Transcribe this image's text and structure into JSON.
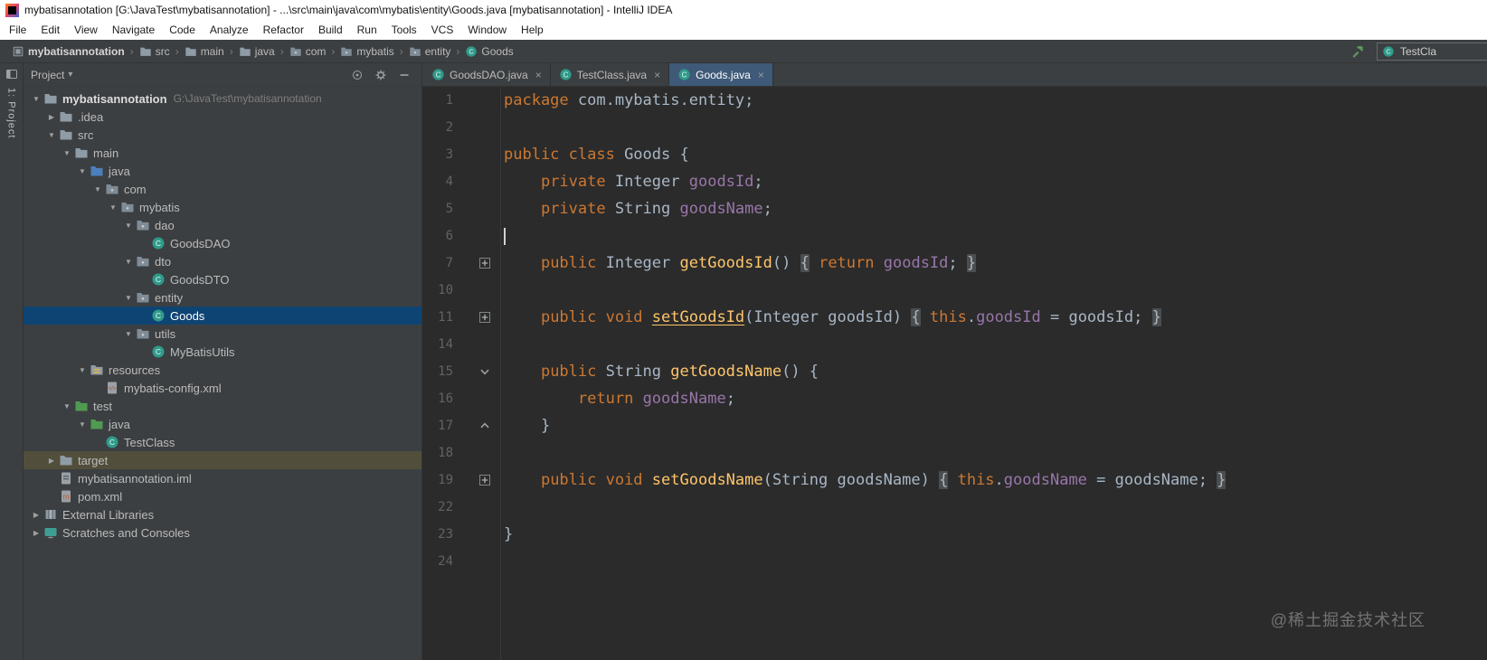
{
  "title_bar": {
    "title": "mybatisannotation [G:\\JavaTest\\mybatisannotation] - ...\\src\\main\\java\\com\\mybatis\\entity\\Goods.java [mybatisannotation] - IntelliJ IDEA"
  },
  "menu_bar": {
    "items": [
      "File",
      "Edit",
      "View",
      "Navigate",
      "Code",
      "Analyze",
      "Refactor",
      "Build",
      "Run",
      "Tools",
      "VCS",
      "Window",
      "Help"
    ]
  },
  "nav_bar": {
    "items": [
      {
        "label": "mybatisannotation",
        "icon": "module"
      },
      {
        "label": "src",
        "icon": "folder"
      },
      {
        "label": "main",
        "icon": "folder"
      },
      {
        "label": "java",
        "icon": "folder"
      },
      {
        "label": "com",
        "icon": "package"
      },
      {
        "label": "mybatis",
        "icon": "package"
      },
      {
        "label": "entity",
        "icon": "package"
      },
      {
        "label": "Goods",
        "icon": "class"
      }
    ],
    "run_config": "TestCla"
  },
  "left_stripe": {
    "project_button": "1: Project"
  },
  "project_panel": {
    "header": {
      "title": "Project"
    },
    "tree": [
      {
        "label": "mybatisannotation",
        "suffix": "G:\\JavaTest\\mybatisannotation",
        "level": 0,
        "chevron": "expanded",
        "icon": "folder",
        "bold": true
      },
      {
        "label": ".idea",
        "level": 1,
        "chevron": "collapsed",
        "icon": "folder"
      },
      {
        "label": "src",
        "level": 1,
        "chevron": "expanded",
        "icon": "folder"
      },
      {
        "label": "main",
        "level": 2,
        "chevron": "expanded",
        "icon": "folder"
      },
      {
        "label": "java",
        "level": 3,
        "chevron": "expanded",
        "icon": "folder-source"
      },
      {
        "label": "com",
        "level": 4,
        "chevron": "expanded",
        "icon": "package"
      },
      {
        "label": "mybatis",
        "level": 5,
        "chevron": "expanded",
        "icon": "package"
      },
      {
        "label": "dao",
        "level": 6,
        "chevron": "expanded",
        "icon": "package"
      },
      {
        "label": "GoodsDAO",
        "level": 7,
        "chevron": "none",
        "icon": "class"
      },
      {
        "label": "dto",
        "level": 6,
        "chevron": "expanded",
        "icon": "package"
      },
      {
        "label": "GoodsDTO",
        "level": 7,
        "chevron": "none",
        "icon": "class"
      },
      {
        "label": "entity",
        "level": 6,
        "chevron": "expanded",
        "icon": "package"
      },
      {
        "label": "Goods",
        "level": 7,
        "chevron": "none",
        "icon": "class",
        "state": "selected"
      },
      {
        "label": "utils",
        "level": 6,
        "chevron": "expanded",
        "icon": "package"
      },
      {
        "label": "MyBatisUtils",
        "level": 7,
        "chevron": "none",
        "icon": "class"
      },
      {
        "label": "resources",
        "level": 3,
        "chevron": "expanded",
        "icon": "folder-resources"
      },
      {
        "label": "mybatis-config.xml",
        "level": 4,
        "chevron": "none",
        "icon": "xml"
      },
      {
        "label": "test",
        "level": 2,
        "chevron": "expanded",
        "icon": "folder-test"
      },
      {
        "label": "java",
        "level": 3,
        "chevron": "expanded",
        "icon": "folder-test"
      },
      {
        "label": "TestClass",
        "level": 4,
        "chevron": "none",
        "icon": "class"
      },
      {
        "label": "target",
        "level": 1,
        "chevron": "collapsed",
        "icon": "folder",
        "state": "highlight-olive"
      },
      {
        "label": "mybatisannotation.iml",
        "level": 1,
        "chevron": "none",
        "icon": "iml"
      },
      {
        "label": "pom.xml",
        "level": 1,
        "chevron": "none",
        "icon": "maven"
      },
      {
        "label": "External Libraries",
        "level": 0,
        "chevron": "collapsed",
        "icon": "library"
      },
      {
        "label": "Scratches and Consoles",
        "level": 0,
        "chevron": "collapsed",
        "icon": "scratch"
      }
    ]
  },
  "editor": {
    "tabs": [
      {
        "label": "GoodsDAO.java",
        "icon": "class",
        "active": false
      },
      {
        "label": "TestClass.java",
        "icon": "class",
        "active": false
      },
      {
        "label": "Goods.java",
        "icon": "class",
        "active": true
      }
    ],
    "lines": [
      {
        "num": "1",
        "segments": [
          [
            "kw",
            "package"
          ],
          [
            "plain",
            " com.mybatis.entity;"
          ]
        ]
      },
      {
        "num": "2",
        "segments": []
      },
      {
        "num": "3",
        "segments": [
          [
            "kw",
            "public class"
          ],
          [
            "plain",
            " Goods {"
          ]
        ]
      },
      {
        "num": "4",
        "segments": [
          [
            "plain",
            "    "
          ],
          [
            "kw",
            "private"
          ],
          [
            "plain",
            " Integer "
          ],
          [
            "field",
            "goodsId"
          ],
          [
            "plain",
            ";"
          ]
        ]
      },
      {
        "num": "5",
        "segments": [
          [
            "plain",
            "    "
          ],
          [
            "kw",
            "private"
          ],
          [
            "plain",
            " String "
          ],
          [
            "field",
            "goodsName"
          ],
          [
            "plain",
            ";"
          ]
        ]
      },
      {
        "num": "6",
        "cursor": true,
        "segments": []
      },
      {
        "num": "7",
        "gutter": "plus",
        "segments": [
          [
            "plain",
            "    "
          ],
          [
            "kw",
            "public"
          ],
          [
            "plain",
            " Integer "
          ],
          [
            "method",
            "getGoodsId"
          ],
          [
            "plain",
            "() "
          ],
          [
            "fold",
            "{"
          ],
          [
            "plain",
            " "
          ],
          [
            "kw",
            "return"
          ],
          [
            "plain",
            " "
          ],
          [
            "field",
            "goodsId"
          ],
          [
            "plain",
            "; "
          ],
          [
            "fold",
            "}"
          ]
        ]
      },
      {
        "num": "10",
        "segments": []
      },
      {
        "num": "11",
        "gutter": "plus",
        "segments": [
          [
            "plain",
            "    "
          ],
          [
            "kw",
            "public void"
          ],
          [
            "plain",
            " "
          ],
          [
            "method-ul",
            "setGoodsId"
          ],
          [
            "plain",
            "(Integer goodsId) "
          ],
          [
            "fold",
            "{"
          ],
          [
            "plain",
            " "
          ],
          [
            "kw",
            "this"
          ],
          [
            "plain",
            "."
          ],
          [
            "field",
            "goodsId"
          ],
          [
            "plain",
            " = goodsId; "
          ],
          [
            "fold",
            "}"
          ]
        ]
      },
      {
        "num": "14",
        "segments": []
      },
      {
        "num": "15",
        "gutter": "fold-open",
        "segments": [
          [
            "plain",
            "    "
          ],
          [
            "kw",
            "public"
          ],
          [
            "plain",
            " String "
          ],
          [
            "method",
            "getGoodsName"
          ],
          [
            "plain",
            "() {"
          ]
        ]
      },
      {
        "num": "16",
        "segments": [
          [
            "plain",
            "        "
          ],
          [
            "kw",
            "return"
          ],
          [
            "plain",
            " "
          ],
          [
            "field",
            "goodsName"
          ],
          [
            "plain",
            ";"
          ]
        ]
      },
      {
        "num": "17",
        "gutter": "fold-close",
        "segments": [
          [
            "plain",
            "    }"
          ]
        ]
      },
      {
        "num": "18",
        "segments": []
      },
      {
        "num": "19",
        "gutter": "plus",
        "segments": [
          [
            "plain",
            "    "
          ],
          [
            "kw",
            "public void"
          ],
          [
            "plain",
            " "
          ],
          [
            "method",
            "setGoodsName"
          ],
          [
            "plain",
            "(String goodsName) "
          ],
          [
            "fold",
            "{"
          ],
          [
            "plain",
            " "
          ],
          [
            "kw",
            "this"
          ],
          [
            "plain",
            "."
          ],
          [
            "field",
            "goodsName"
          ],
          [
            "plain",
            " = goodsName; "
          ],
          [
            "fold",
            "}"
          ]
        ]
      },
      {
        "num": "22",
        "segments": []
      },
      {
        "num": "23",
        "segments": [
          [
            "plain",
            "}"
          ]
        ]
      },
      {
        "num": "24",
        "segments": []
      }
    ],
    "watermark": "@稀土掘金技术社区"
  },
  "colors": {
    "editor_bg": "#2b2b2b",
    "panel_bg": "#3c3f41",
    "selection_blue": "#0e4473",
    "target_highlight": "#514e3b",
    "keyword_orange": "#cc7832",
    "field_purple": "#9876aa",
    "method_yellow": "#ffc66b",
    "active_tab_blue": "#3e5a78"
  }
}
